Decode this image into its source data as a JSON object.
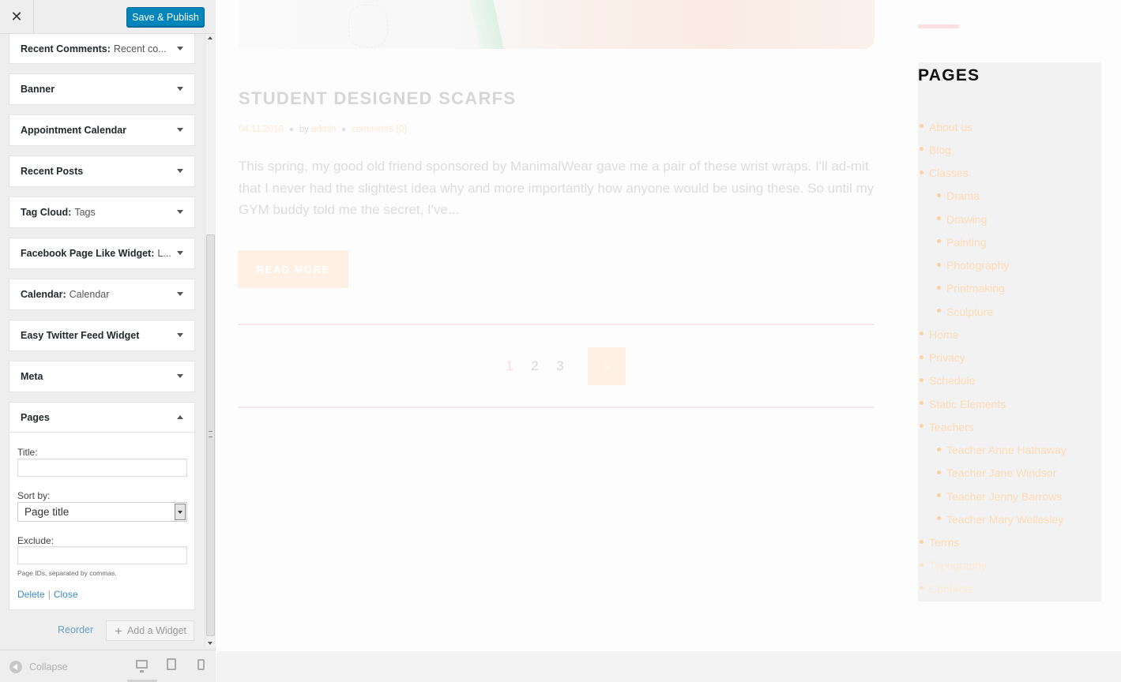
{
  "topbar": {
    "close_icon": "✕",
    "save_label": "Save & Publish"
  },
  "widgets": [
    {
      "name": "Recent Comments:",
      "sub": "Recent co..."
    },
    {
      "name": "Banner",
      "sub": ""
    },
    {
      "name": "Appointment Calendar",
      "sub": ""
    },
    {
      "name": "Recent Posts",
      "sub": ""
    },
    {
      "name": "Tag Cloud:",
      "sub": "Tags"
    },
    {
      "name": "Facebook Page Like Widget:",
      "sub": "L..."
    },
    {
      "name": "Calendar:",
      "sub": "Calendar"
    },
    {
      "name": "Easy Twitter Feed Widget",
      "sub": ""
    },
    {
      "name": "Meta",
      "sub": ""
    }
  ],
  "pages_widget": {
    "name": "Pages",
    "title_label": "Title:",
    "title_value": "",
    "sort_label": "Sort by:",
    "sort_value": "Page title",
    "exclude_label": "Exclude:",
    "exclude_value": "",
    "help_text": "Page IDs, separated by commas.",
    "delete_label": "Delete",
    "separator": "|",
    "close_label": "Close"
  },
  "sidebar_footer": {
    "reorder_label": "Reorder",
    "add_widget_label": "Add a Widget",
    "collapse_label": "Collapse"
  },
  "post": {
    "title": "STUDENT DESIGNED SCARFS",
    "date": "04.11.2016",
    "by": "by",
    "author": "admin",
    "comments": "comments (0)",
    "excerpt": "This spring, my good old friend sponsored by ManimalWear gave me a pair of these wrist wraps. I'll ad-mit that I never had the slightest idea why and more importantly how anyone would be using these. So until my GYM buddy told me the secret, I've...",
    "read_more": "READ MORE"
  },
  "pagination": {
    "pages": [
      "1",
      "2",
      "3"
    ],
    "current": "1",
    "next_icon": "›"
  },
  "pages_sidebar": {
    "heading": "PAGES",
    "items": [
      {
        "label": "About us",
        "level": 0
      },
      {
        "label": "Blog",
        "level": 0
      },
      {
        "label": "Classes",
        "level": 0
      },
      {
        "label": "Drama",
        "level": 1
      },
      {
        "label": "Drawing",
        "level": 1
      },
      {
        "label": "Painting",
        "level": 1
      },
      {
        "label": "Photography",
        "level": 1
      },
      {
        "label": "Printmaking",
        "level": 1
      },
      {
        "label": "Sculpture",
        "level": 1
      },
      {
        "label": "Home",
        "level": 0
      },
      {
        "label": "Privacy",
        "level": 0
      },
      {
        "label": "Schedule",
        "level": 0
      },
      {
        "label": "Static Elements",
        "level": 0
      },
      {
        "label": "Teachers",
        "level": 0
      },
      {
        "label": "Teacher Anne Hathaway",
        "level": 1
      },
      {
        "label": "Teacher Jane Windsor",
        "level": 1
      },
      {
        "label": "Teacher Jenny Barrows",
        "level": 1
      },
      {
        "label": "Teacher Mary Wellesley",
        "level": 1
      },
      {
        "label": "Terms",
        "level": 0
      },
      {
        "label": "Typography",
        "level": 0
      },
      {
        "label": "Contacts",
        "level": 0
      }
    ]
  },
  "colors": {
    "primary_button": "#0085ba",
    "link_color": "#fddcb5",
    "accent_pink": "#fcdfe3"
  }
}
